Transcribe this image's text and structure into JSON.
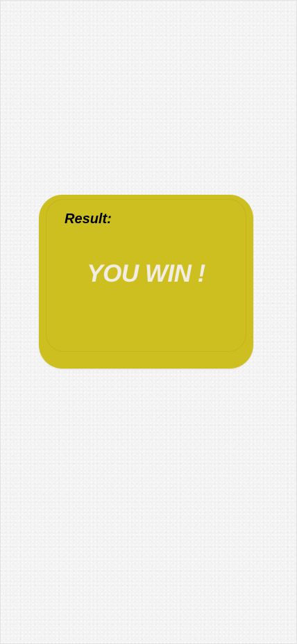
{
  "result": {
    "label": "Result:",
    "value": "YOU WIN !"
  },
  "colors": {
    "background": "#f3f3f3",
    "card": "#cdbf1f",
    "label_text": "#000000",
    "value_text": "#f1ede4"
  }
}
